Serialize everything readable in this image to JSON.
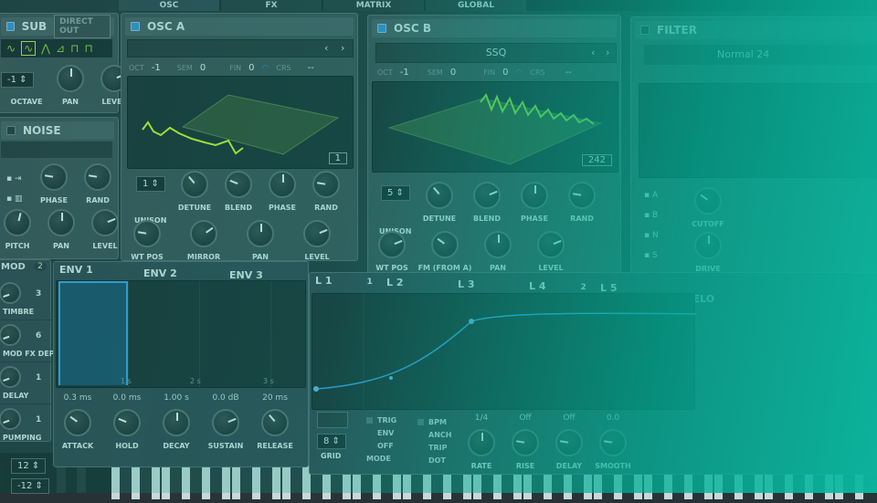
{
  "top_tabs": [
    "OSC",
    "FX",
    "MATRIX",
    "GLOBAL"
  ],
  "sub": {
    "title": "SUB",
    "direct_out": "DIRECT OUT",
    "octave_value": "-1",
    "knobs": [
      {
        "label": "OCTAVE",
        "value": null
      },
      {
        "label": "PAN",
        "value": 0.5
      },
      {
        "label": "LEVEL",
        "value": 0.75
      }
    ]
  },
  "noise": {
    "title": "NOISE",
    "knobs_top": [
      {
        "label": "PHASE",
        "value": 0.2
      },
      {
        "label": "RAND",
        "value": 0.2
      }
    ],
    "knobs_bottom": [
      {
        "label": "PITCH",
        "value": 0.55
      },
      {
        "label": "PAN",
        "value": 0.5
      },
      {
        "label": "LEVEL",
        "value": 0.75
      }
    ]
  },
  "osc_a": {
    "title": "OSC A",
    "oct_label": "OCT",
    "oct": "-1",
    "sem_label": "SEM",
    "sem": "0",
    "fin_label": "FIN",
    "fin": "0",
    "crs_label": "CRS",
    "crs": "--",
    "frame": "1",
    "unison": "1",
    "knobs_top": [
      {
        "label": "DETUNE",
        "value": 0.35
      },
      {
        "label": "BLEND",
        "value": 0.25
      },
      {
        "label": "PHASE",
        "value": 0.5
      },
      {
        "label": "RAND",
        "value": 0.2
      }
    ],
    "knobs_bottom": [
      {
        "label": "WT POS",
        "value": 0.2
      },
      {
        "label": "MIRROR",
        "value": 0.7
      },
      {
        "label": "PAN",
        "value": 0.5
      },
      {
        "label": "LEVEL",
        "value": 0.75
      }
    ],
    "unison_label": "UNISON",
    "wave_color": "#c8f020"
  },
  "osc_b": {
    "title": "OSC B",
    "wavetable": "SSQ",
    "oct_label": "OCT",
    "oct": "-1",
    "sem_label": "SEM",
    "sem": "0",
    "fin_label": "FIN",
    "fin": "0",
    "crs_label": "CRS",
    "crs": "--",
    "frame": "242",
    "unison": "5",
    "knobs_top": [
      {
        "label": "DETUNE",
        "value": 0.35
      },
      {
        "label": "BLEND",
        "value": 0.75
      },
      {
        "label": "PHASE",
        "value": 0.5
      },
      {
        "label": "RAND",
        "value": 0.2
      }
    ],
    "knobs_bottom": [
      {
        "label": "WT POS",
        "value": 0.75
      },
      {
        "label": "FM (FROM A)",
        "value": 0.3
      },
      {
        "label": "PAN",
        "value": 0.5
      },
      {
        "label": "LEVEL",
        "value": 0.75
      }
    ],
    "unison_label": "UNISON"
  },
  "filter": {
    "title": "FILTER",
    "type": "Normal 24",
    "routes": [
      "A",
      "B",
      "N",
      "S"
    ],
    "knobs": [
      {
        "label": "CUTOFF",
        "value": 0.3
      },
      {
        "label": "DRIVE",
        "value": 0.5
      }
    ]
  },
  "mod": {
    "title": "MOD",
    "count": "2",
    "macros": [
      {
        "label": "TIMBRE",
        "count": "3",
        "value": 0.25
      },
      {
        "label": "MOD FX DEPTH",
        "count": "6",
        "value": 0.25
      },
      {
        "label": "DELAY",
        "count": "1",
        "value": 0.25
      },
      {
        "label": "PUMPING",
        "count": "1",
        "value": 0.25
      }
    ]
  },
  "env": {
    "tabs": [
      "ENV 1",
      "ENV 2",
      "ENV 3"
    ],
    "knobs": [
      {
        "label": "ATTACK",
        "value_text": "0.3 ms",
        "value": 0.3
      },
      {
        "label": "HOLD",
        "value_text": "0.0 ms",
        "value": 0.25
      },
      {
        "label": "DECAY",
        "value_text": "1.00 s",
        "value": 0.5
      },
      {
        "label": "SUSTAIN",
        "value_text": "0.0 dB",
        "value": 0.75
      },
      {
        "label": "RELEASE",
        "value_text": "20 ms",
        "value": 0.35
      }
    ],
    "grid_labels": [
      "1 s",
      "2 s",
      "3 s"
    ],
    "curve_color": "#3a9ce0"
  },
  "lfo": {
    "tabs": [
      {
        "label": "L 1",
        "count": "1"
      },
      {
        "label": "L 2",
        "count": ""
      },
      {
        "label": "L 3",
        "count": ""
      },
      {
        "label": "L 4",
        "count": "2"
      },
      {
        "label": "L 5",
        "count": ""
      }
    ],
    "velo": "VELO",
    "grid_value": "8",
    "grid_label": "GRID",
    "mode_options": [
      "TRIG",
      "ENV",
      "OFF"
    ],
    "mode_label": "MODE",
    "bpm_options": [
      "BPM",
      "ANCH",
      "TRIP",
      "DOT"
    ],
    "knobs": [
      {
        "label": "RATE",
        "value_text": "1/4",
        "value": 0.5
      },
      {
        "label": "RISE",
        "value_text": "Off",
        "value": 0.2
      },
      {
        "label": "DELAY",
        "value_text": "Off",
        "value": 0.2
      },
      {
        "label": "SMOOTH",
        "value_text": "0.0",
        "value": 0.2
      }
    ]
  },
  "keyboard": {
    "pitch_up": "12",
    "pitch_down": "-12"
  }
}
